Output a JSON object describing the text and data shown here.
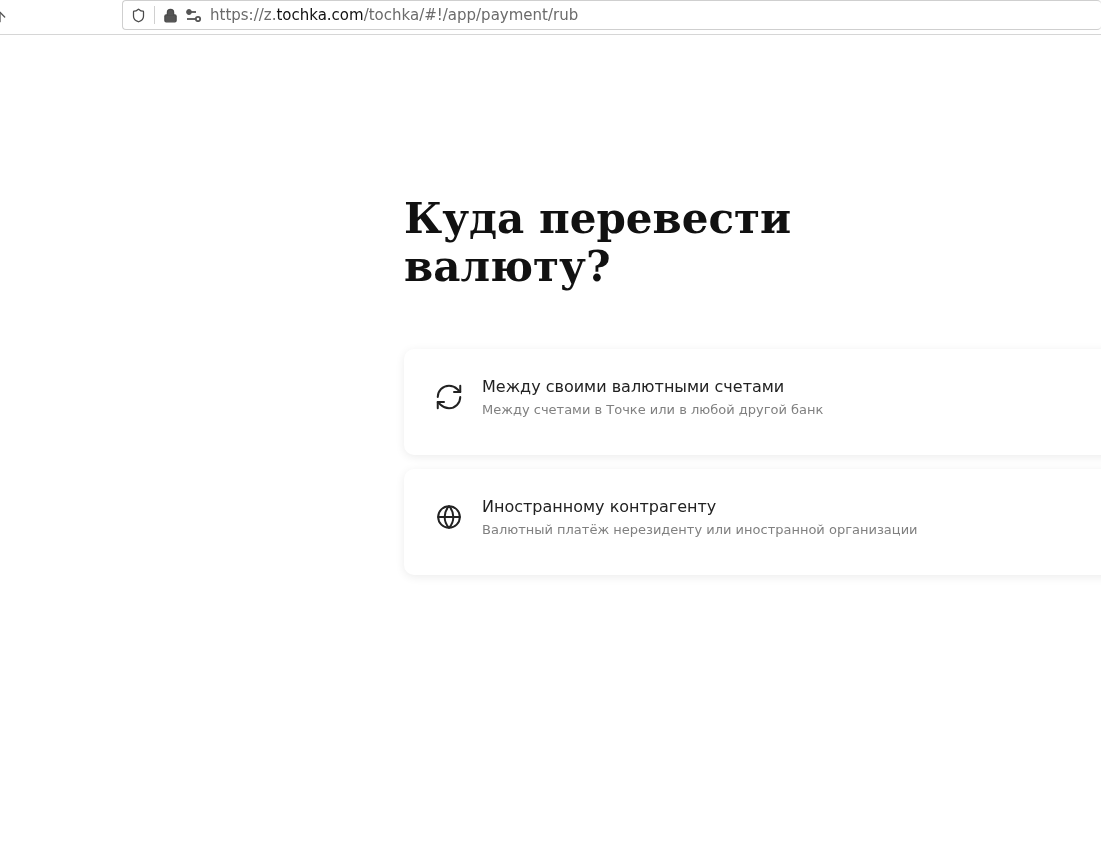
{
  "browser": {
    "url": "https://z.**tochka.com**/tochka/#!/app/payment/rub"
  },
  "page": {
    "title": "Куда перевести валюту?",
    "options": [
      {
        "kind": "exchange",
        "title": "Между своими валютными счетами",
        "subtitle": "Между счетами в Точке или в любой другой банк"
      },
      {
        "kind": "globe",
        "title": "Иностранному контрагенту",
        "subtitle": "Валютный платёж нерезиденту или иностранной организации"
      }
    ]
  }
}
